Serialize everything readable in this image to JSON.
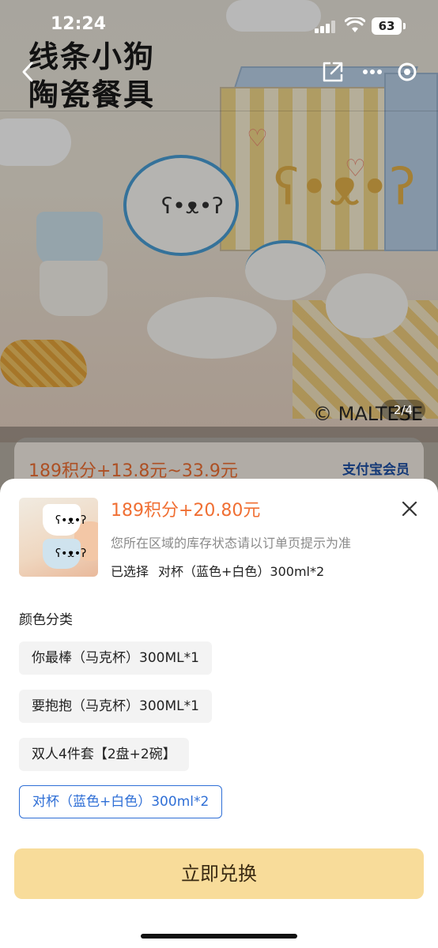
{
  "status_bar": {
    "time": "12:24",
    "battery": "63"
  },
  "hero": {
    "title_line1": "线条小狗",
    "title_line2": "陶瓷餐具",
    "watermark": "© MALTESE",
    "pager": "2/4"
  },
  "listing": {
    "price": "189积分+13.8元~33.9元",
    "member_badge": "支付宝会员"
  },
  "sheet": {
    "price": "189积分+20.80元",
    "stock_note": "您所在区域的库存状态请以订单页提示为准",
    "selected_label": "已选择",
    "selected_value": "对杯（蓝色+白色）300ml*2",
    "section_label": "颜色分类",
    "options": [
      {
        "label": "你最棒（马克杯）300ML*1",
        "active": false
      },
      {
        "label": "要抱抱（马克杯）300ML*1",
        "active": false
      },
      {
        "label": "双人4件套【2盘+2碗】",
        "active": false
      },
      {
        "label": "对杯（蓝色+白色）300ml*2",
        "active": true
      }
    ],
    "cta_label": "立即兑换"
  },
  "colors": {
    "price_orange": "#f06f33",
    "active_blue": "#2f6fd6",
    "cta_yellow": "#f8dc9a"
  },
  "icons": [
    "back-icon",
    "share-icon",
    "more-icon",
    "mini-program-close-icon",
    "close-icon",
    "signal-icon",
    "wifi-icon",
    "battery-icon"
  ]
}
